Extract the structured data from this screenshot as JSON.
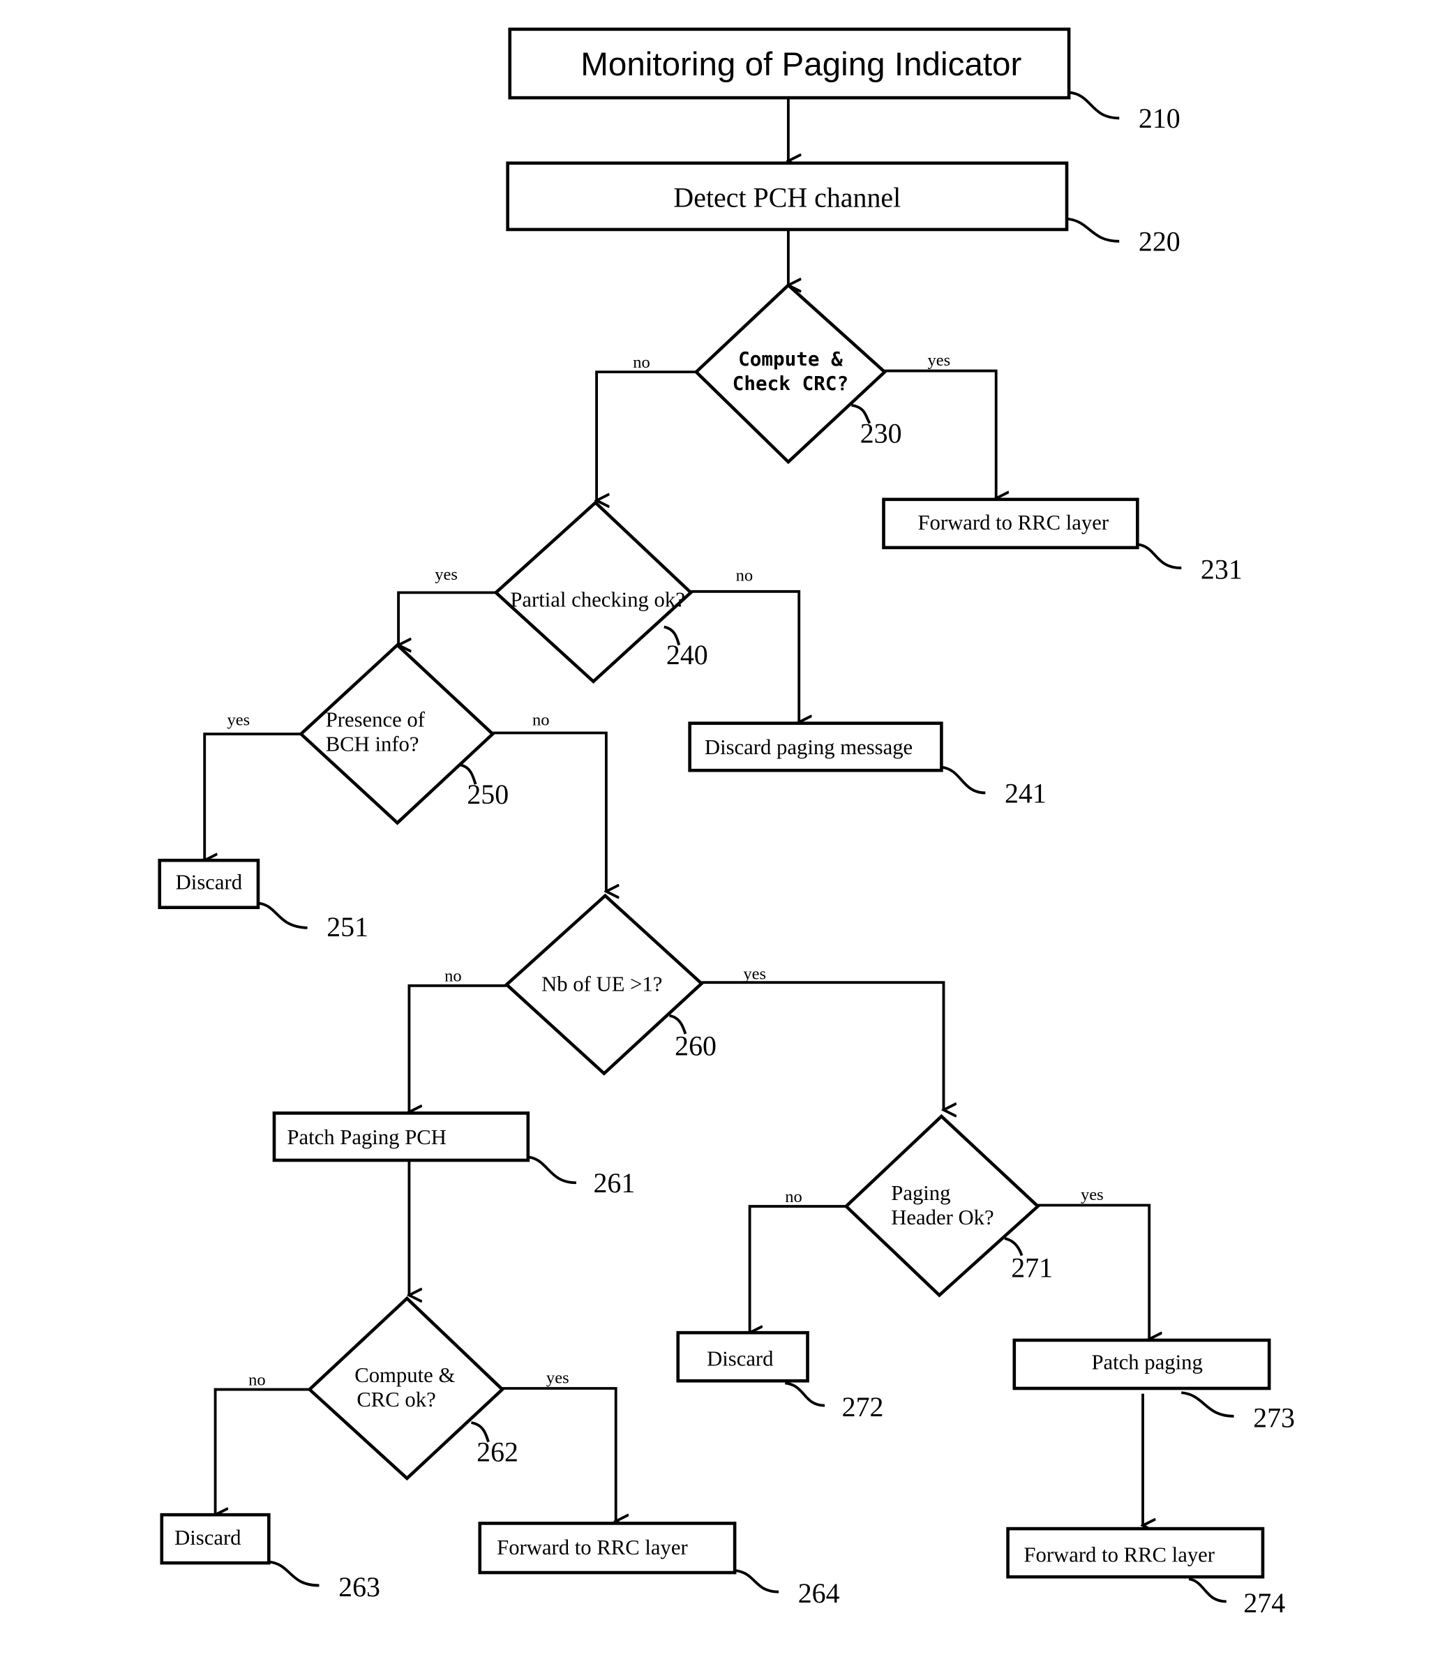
{
  "nodes": {
    "n210": {
      "text": "Monitoring of Paging Indicator",
      "ref": "210"
    },
    "n220": {
      "text": "Detect PCH channel",
      "ref": "220"
    },
    "n230": {
      "line1": "Compute &",
      "line2": "Check CRC?",
      "ref": "230"
    },
    "n231": {
      "text": "Forward to RRC layer",
      "ref": "231"
    },
    "n240": {
      "text": "Partial checking ok?",
      "ref": "240"
    },
    "n241": {
      "text": "Discard paging message",
      "ref": "241"
    },
    "n250": {
      "line1": "Presence of",
      "line2": "BCH info?",
      "ref": "250"
    },
    "n251": {
      "text": "Discard",
      "ref": "251"
    },
    "n260": {
      "text": "Nb of UE >1?",
      "ref": "260"
    },
    "n261": {
      "text": "Patch Paging PCH",
      "ref": "261"
    },
    "n262": {
      "line1": "Compute &",
      "line2": "CRC ok?",
      "ref": "262"
    },
    "n263": {
      "text": "Discard",
      "ref": "263"
    },
    "n264": {
      "text": "Forward to RRC layer",
      "ref": "264"
    },
    "n271": {
      "line1": "Paging",
      "line2": "Header Ok?",
      "ref": "271"
    },
    "n272": {
      "text": "Discard",
      "ref": "272"
    },
    "n273": {
      "text": "Patch paging",
      "ref": "273"
    },
    "n274": {
      "text": "Forward to RRC layer",
      "ref": "274"
    }
  },
  "labels": {
    "yes": "yes",
    "no": "no"
  }
}
